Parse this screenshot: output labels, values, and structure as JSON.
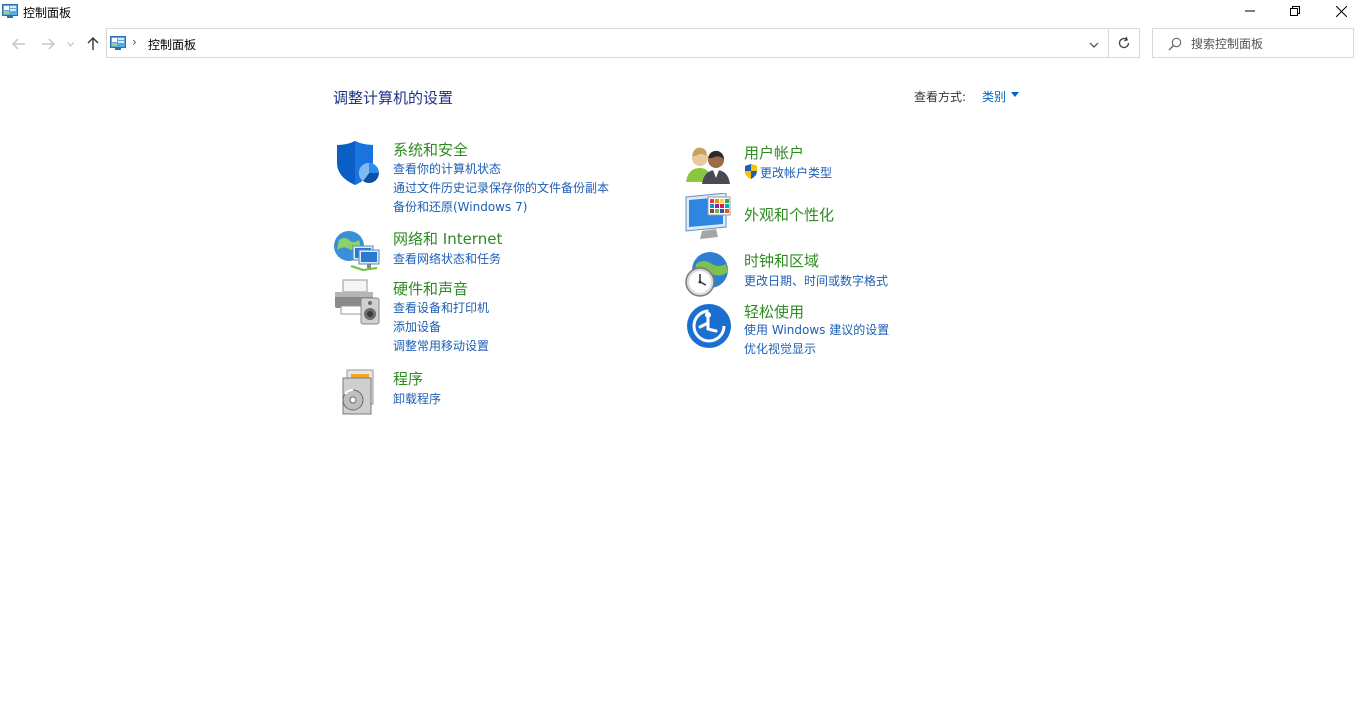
{
  "window": {
    "title": "控制面板"
  },
  "address": {
    "crumb": "控制面板",
    "separator": "›"
  },
  "search": {
    "placeholder": "搜索控制面板"
  },
  "main": {
    "heading": "调整计算机的设置",
    "view_by_label": "查看方式:",
    "view_by_value": "类别"
  },
  "categories": {
    "system": {
      "title": "系统和安全",
      "links": [
        "查看你的计算机状态",
        "通过文件历史记录保存你的文件备份副本",
        "备份和还原(Windows 7)"
      ],
      "icon": "security-shield-icon"
    },
    "network": {
      "title": "网络和 Internet",
      "links": [
        "查看网络状态和任务"
      ],
      "icon": "network-globe-icon"
    },
    "hardware": {
      "title": "硬件和声音",
      "links": [
        "查看设备和打印机",
        "添加设备",
        "调整常用移动设置"
      ],
      "icon": "printer-speaker-icon"
    },
    "programs": {
      "title": "程序",
      "links": [
        "卸载程序"
      ],
      "icon": "programs-disc-icon"
    },
    "users": {
      "title": "用户帐户",
      "links": [
        "更改帐户类型"
      ],
      "icon": "users-icon"
    },
    "appearance": {
      "title": "外观和个性化",
      "links": [],
      "icon": "monitor-palette-icon"
    },
    "clock": {
      "title": "时钟和区域",
      "links": [
        "更改日期、时间或数字格式"
      ],
      "icon": "clock-globe-icon"
    },
    "ease": {
      "title": "轻松使用",
      "links": [
        "使用 Windows 建议的设置",
        "优化视觉显示"
      ],
      "icon": "ease-of-access-icon"
    }
  },
  "colors": {
    "heading": "#1e3287",
    "category_title": "#2e8b22",
    "link": "#1e5fb4",
    "accent_blue": "#0066cc"
  }
}
